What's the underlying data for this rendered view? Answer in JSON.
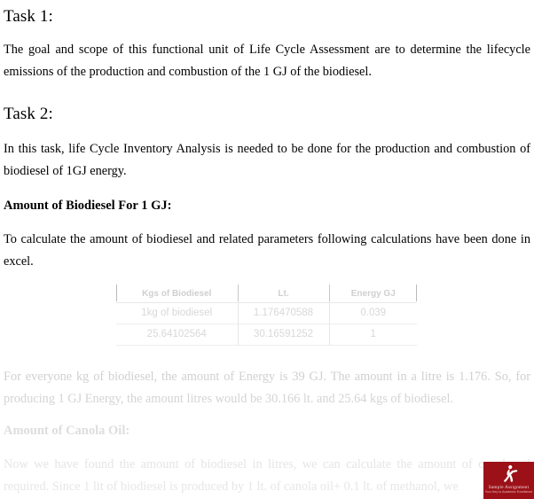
{
  "document": {
    "task1": {
      "heading": "Task 1:",
      "paragraph": "The goal and scope of this functional unit of Life Cycle Assessment are to determine the lifecycle emissions of the production and combustion of the 1 GJ of the biodiesel."
    },
    "task2": {
      "heading": "Task 2:",
      "paragraph": "In this task, life Cycle Inventory Analysis is needed to be done for the production and combustion of biodiesel of 1GJ energy."
    },
    "amount_section": {
      "heading": "Amount of Biodiesel For 1 GJ:",
      "paragraph": "To calculate the amount of biodiesel and related parameters following calculations have been done in excel."
    },
    "table": {
      "headers": [
        "Kgs of Biodiesel",
        "Lt.",
        "Energy GJ"
      ],
      "rows": [
        [
          "1kg of biodiesel",
          "1.176470588",
          "0.039"
        ],
        [
          "25.64102564",
          "30.16591252",
          "1"
        ]
      ]
    },
    "fade_section": {
      "paragraph_1": "For everyone kg of biodiesel, the amount of Energy is 39 GJ. The amount in a litre is 1.176. So, for producing 1 GJ Energy, the amount litres would be 30.166 lt. and 25.64 kgs of biodiesel.",
      "canola_heading": "Amount of Canola Oil:",
      "paragraph_2": "Now we have found the amount of biodiesel in litres, we can calculate the amount of canola oil required. Since 1 lit of biodiesel is produced by 1 lt. of canola oil+ 0.1 lt. of methanol, we"
    }
  },
  "watermark": {
    "name": "Sample Assignment",
    "tagline": "Your Key to Academic Excellence",
    "icon": "dancing-figure-logo-icon",
    "color": "#9c1118"
  }
}
